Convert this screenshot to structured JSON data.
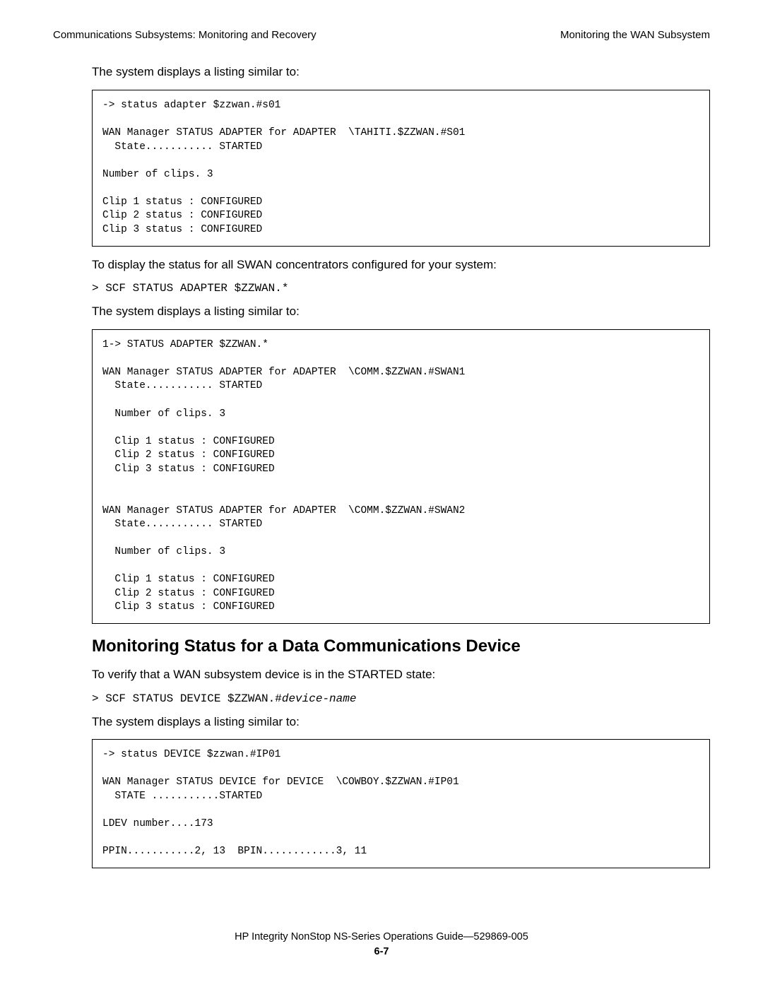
{
  "header": {
    "left": "Communications Subsystems: Monitoring and Recovery",
    "right": "Monitoring the WAN Subsystem"
  },
  "body": {
    "p1": "The system displays a listing similar to:",
    "code1": "-> status adapter $zzwan.#s01\n\nWAN Manager STATUS ADAPTER for ADAPTER  \\TAHITI.$ZZWAN.#S01\n  State........... STARTED\n\nNumber of clips. 3\n\nClip 1 status : CONFIGURED\nClip 2 status : CONFIGURED\nClip 3 status : CONFIGURED",
    "p2": "To display the status for all SWAN concentrators configured for your system:",
    "cmd1": "> SCF STATUS ADAPTER $ZZWAN.*",
    "p3": "The system displays a listing similar to:",
    "code2": "1-> STATUS ADAPTER $ZZWAN.*\n\nWAN Manager STATUS ADAPTER for ADAPTER  \\COMM.$ZZWAN.#SWAN1\n  State........... STARTED\n\n  Number of clips. 3\n\n  Clip 1 status : CONFIGURED\n  Clip 2 status : CONFIGURED\n  Clip 3 status : CONFIGURED\n\n\nWAN Manager STATUS ADAPTER for ADAPTER  \\COMM.$ZZWAN.#SWAN2\n  State........... STARTED\n\n  Number of clips. 3\n\n  Clip 1 status : CONFIGURED\n  Clip 2 status : CONFIGURED\n  Clip 3 status : CONFIGURED",
    "h2": "Monitoring Status for a Data Communications Device",
    "p4": "To verify that a WAN subsystem device is in the STARTED state:",
    "cmd2_pre": "> SCF STATUS DEVICE $ZZWAN.#",
    "cmd2_it": "device-name",
    "p5": "The system displays a listing similar to:",
    "code3": "-> status DEVICE $zzwan.#IP01\n\nWAN Manager STATUS DEVICE for DEVICE  \\COWBOY.$ZZWAN.#IP01\n  STATE ...........STARTED\n\nLDEV number....173\n\nPPIN...........2, 13  BPIN............3, 11"
  },
  "footer": {
    "line": "HP Integrity NonStop NS-Series Operations Guide—529869-005",
    "page": "6-7"
  }
}
